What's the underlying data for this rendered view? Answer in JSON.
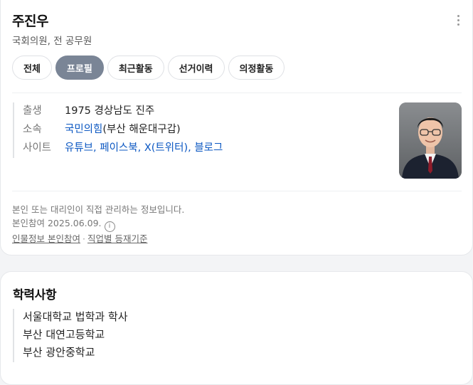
{
  "profile": {
    "name": "주진우",
    "subtitle": "국회의원, 전 공무원"
  },
  "tabs": [
    {
      "label": "전체",
      "active": false
    },
    {
      "label": "프로필",
      "active": true
    },
    {
      "label": "최근활동",
      "active": false
    },
    {
      "label": "선거이력",
      "active": false
    },
    {
      "label": "의정활동",
      "active": false
    }
  ],
  "info": {
    "birth": {
      "label": "출생",
      "value": "1975 경상남도 진주"
    },
    "affiliation": {
      "label": "소속",
      "party": "국민의힘",
      "district": "(부산 해운대구갑)"
    },
    "sites": {
      "label": "사이트",
      "links": [
        "유튜브",
        "페이스북",
        "X(트위터)",
        "블로그"
      ],
      "separator": ", "
    }
  },
  "notice": {
    "line1": "본인 또는 대리인이 직접 관리하는 정보입니다.",
    "line2": "본인참여 2025.06.09.",
    "info_icon": "i",
    "link1": "인물정보 본인참여",
    "sep": "·",
    "link2": "직업별 등재기준"
  },
  "education": {
    "title": "학력사항",
    "items": [
      "서울대학교 법학과 학사",
      "부산 대연고등학교",
      "부산 광안중학교"
    ]
  },
  "colors": {
    "accent": "#0b57c2",
    "active_tab": "#7a8596"
  }
}
